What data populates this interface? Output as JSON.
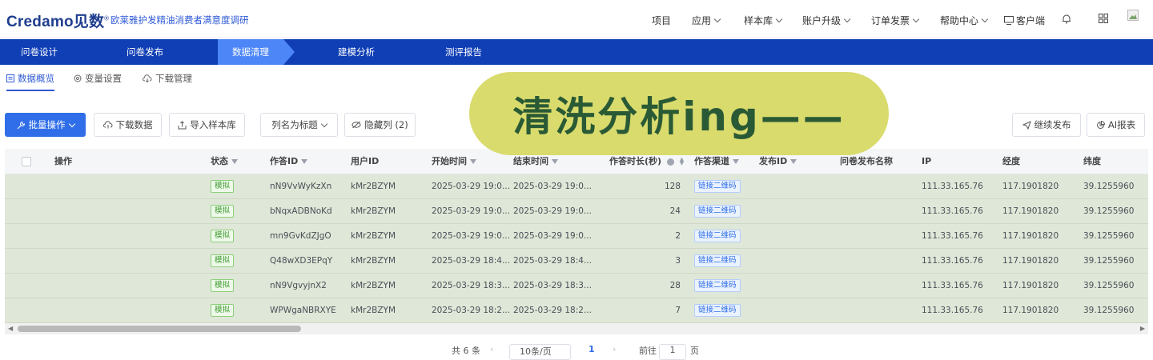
{
  "header": {
    "logo_text": "Credamo",
    "logo_cn": "见数",
    "logo_mark": "®",
    "survey_title": "欧莱雅护发精油消费者满意度调研",
    "nav": [
      {
        "label": "项目",
        "has_dropdown": false
      },
      {
        "label": "应用",
        "has_dropdown": true
      },
      {
        "label": "样本库",
        "has_dropdown": true
      },
      {
        "label": "账户升级",
        "has_dropdown": true
      },
      {
        "label": "订单发票",
        "has_dropdown": true
      },
      {
        "label": "帮助中心",
        "has_dropdown": true
      },
      {
        "label": "客户端",
        "has_dropdown": false
      }
    ]
  },
  "steps": {
    "items": [
      "问卷设计",
      "问卷发布",
      "数据清理",
      "建模分析",
      "测评报告"
    ],
    "active": "数据清理"
  },
  "subtabs": {
    "items": [
      "数据概览",
      "变量设置",
      "下载管理"
    ],
    "active": "数据概览"
  },
  "sticker_text": "清洗分析ing——",
  "toolbar": {
    "batch": "批量操作",
    "download": "下载数据",
    "import": "导入样本库",
    "col_title": "列名为标题",
    "hidden_cols": "隐藏列 (2)",
    "continue_publish": "继续发布",
    "ai_report": "AI报表"
  },
  "table": {
    "columns": [
      "操作",
      "状态",
      "作答ID",
      "用户ID",
      "开始时间",
      "结束时间",
      "作答时长(秒)",
      "作答渠道",
      "发布ID",
      "问卷发布名称",
      "IP",
      "经度",
      "纬度"
    ],
    "rows": [
      {
        "status": "模拟",
        "answer_id": "nN9VvWyKzXn",
        "user_id": "kMr2BZYM",
        "start": "2025-03-29 19:0...",
        "end": "2025-03-29 19:0...",
        "duration": "128",
        "channel": "链接二维码",
        "ip": "111.33.165.76",
        "lng": "117.1901820",
        "lat": "39.1255960"
      },
      {
        "status": "模拟",
        "answer_id": "bNqxADBNoKd",
        "user_id": "kMr2BZYM",
        "start": "2025-03-29 19:0...",
        "end": "2025-03-29 19:0...",
        "duration": "24",
        "channel": "链接二维码",
        "ip": "111.33.165.76",
        "lng": "117.1901820",
        "lat": "39.1255960"
      },
      {
        "status": "模拟",
        "answer_id": "mn9GvKdZJgO",
        "user_id": "kMr2BZYM",
        "start": "2025-03-29 19:0...",
        "end": "2025-03-29 19:0...",
        "duration": "2",
        "channel": "链接二维码",
        "ip": "111.33.165.76",
        "lng": "117.1901820",
        "lat": "39.1255960"
      },
      {
        "status": "模拟",
        "answer_id": "Q48wXD3EPqY",
        "user_id": "kMr2BZYM",
        "start": "2025-03-29 18:4...",
        "end": "2025-03-29 18:4...",
        "duration": "3",
        "channel": "链接二维码",
        "ip": "111.33.165.76",
        "lng": "117.1901820",
        "lat": "39.1255960"
      },
      {
        "status": "模拟",
        "answer_id": "nN9VgvyjnX2",
        "user_id": "kMr2BZYM",
        "start": "2025-03-29 18:3...",
        "end": "2025-03-29 18:3...",
        "duration": "28",
        "channel": "链接二维码",
        "ip": "111.33.165.76",
        "lng": "117.1901820",
        "lat": "39.1255960"
      },
      {
        "status": "模拟",
        "answer_id": "WPWgaNBRXYE",
        "user_id": "kMr2BZYM",
        "start": "2025-03-29 18:2...",
        "end": "2025-03-29 18:2...",
        "duration": "7",
        "channel": "链接二维码",
        "ip": "111.33.165.76",
        "lng": "117.1901820",
        "lat": "39.1255960"
      }
    ]
  },
  "pager": {
    "total": "共 6 条",
    "page_size": "10条/页",
    "current": "1",
    "goto_label": "前往",
    "goto_value": "1",
    "page_unit": "页"
  },
  "colors": {
    "brand": "#0f3eb5",
    "active_step": "#4d86f7",
    "primary": "#2f6ee8",
    "row_bg": "#dfe7d8",
    "sticker": "#d9db6d"
  }
}
